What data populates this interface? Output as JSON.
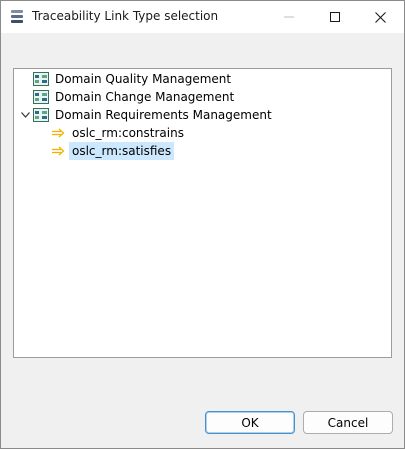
{
  "window": {
    "title": "Traceability Link Type selection"
  },
  "tree": {
    "items": [
      {
        "label": "Domain Quality Management",
        "icon": "domain-icon",
        "expanded": false
      },
      {
        "label": "Domain Change Management",
        "icon": "domain-icon",
        "expanded": false
      },
      {
        "label": "Domain Requirements Management",
        "icon": "domain-icon",
        "expanded": true,
        "children": [
          {
            "label": "oslc_rm:constrains",
            "icon": "link-arrow-icon",
            "selected": false
          },
          {
            "label": "oslc_rm:satisfies",
            "icon": "link-arrow-icon",
            "selected": true
          }
        ]
      }
    ]
  },
  "buttons": {
    "ok_label": "OK",
    "cancel_label": "Cancel"
  },
  "colors": {
    "selection": "#cce8ff",
    "link_arrow": "#f0b400",
    "domain_icon_fill": "#5aa58c",
    "ok_border": "#4a90c8"
  }
}
